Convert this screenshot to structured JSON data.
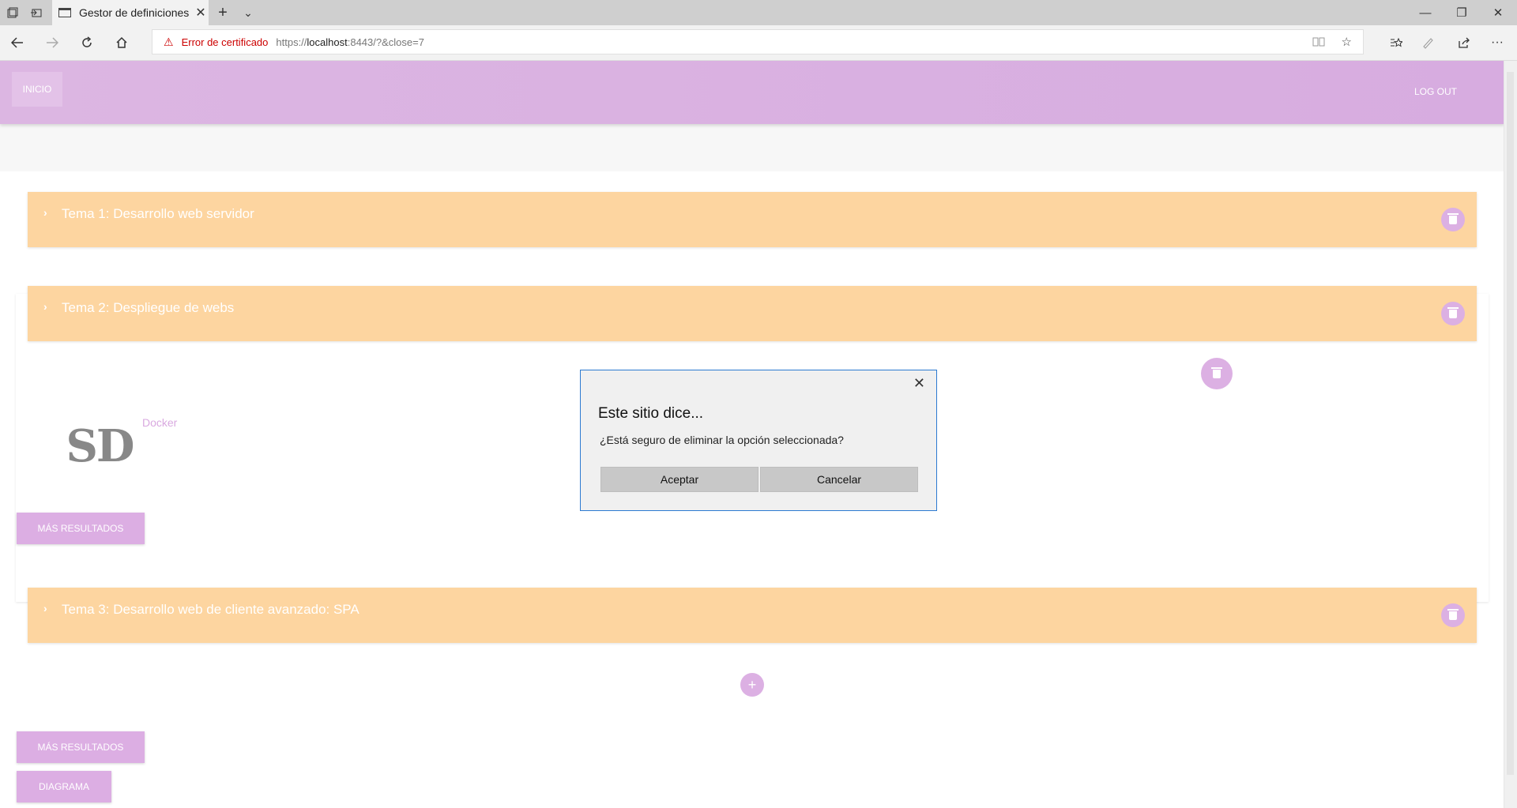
{
  "browser": {
    "tab_title": "Gestor de definiciones",
    "tab_close": "✕",
    "new_tab": "+",
    "tab_menu": "⌄",
    "cert_error": "Error de certificado",
    "url_prefix": "https://",
    "url_host": "localhost",
    "url_rest": ":8443/?&close=7",
    "window_controls": [
      "—",
      "❐",
      "✕"
    ],
    "more_label": "···"
  },
  "header": {
    "home_label": "INICIO",
    "logout_label": "LOG OUT"
  },
  "topics": [
    {
      "title": "Tema 1: Desarrollo web servidor"
    },
    {
      "title": "Tema 2: Despliegue de webs"
    },
    {
      "title": "Tema 3: Desarrollo web de cliente avanzado: SPA"
    }
  ],
  "expanded_item": {
    "logo_text": "SD",
    "link_label": "Docker"
  },
  "buttons": {
    "more_results_label": "MÁS RESULTADOS",
    "diagram_label": "DIAGRAMA",
    "add_label": "+"
  },
  "dialog": {
    "title": "Este sitio dice...",
    "message": "¿Está seguro de eliminar la opción seleccionada?",
    "accept_label": "Aceptar",
    "cancel_label": "Cancelar",
    "close_label": "✕"
  },
  "colors": {
    "header": "#d9b0e1",
    "accent": "#dcaee3",
    "panel": "#fdd5a0",
    "dialog_border": "#2b7ad1"
  }
}
